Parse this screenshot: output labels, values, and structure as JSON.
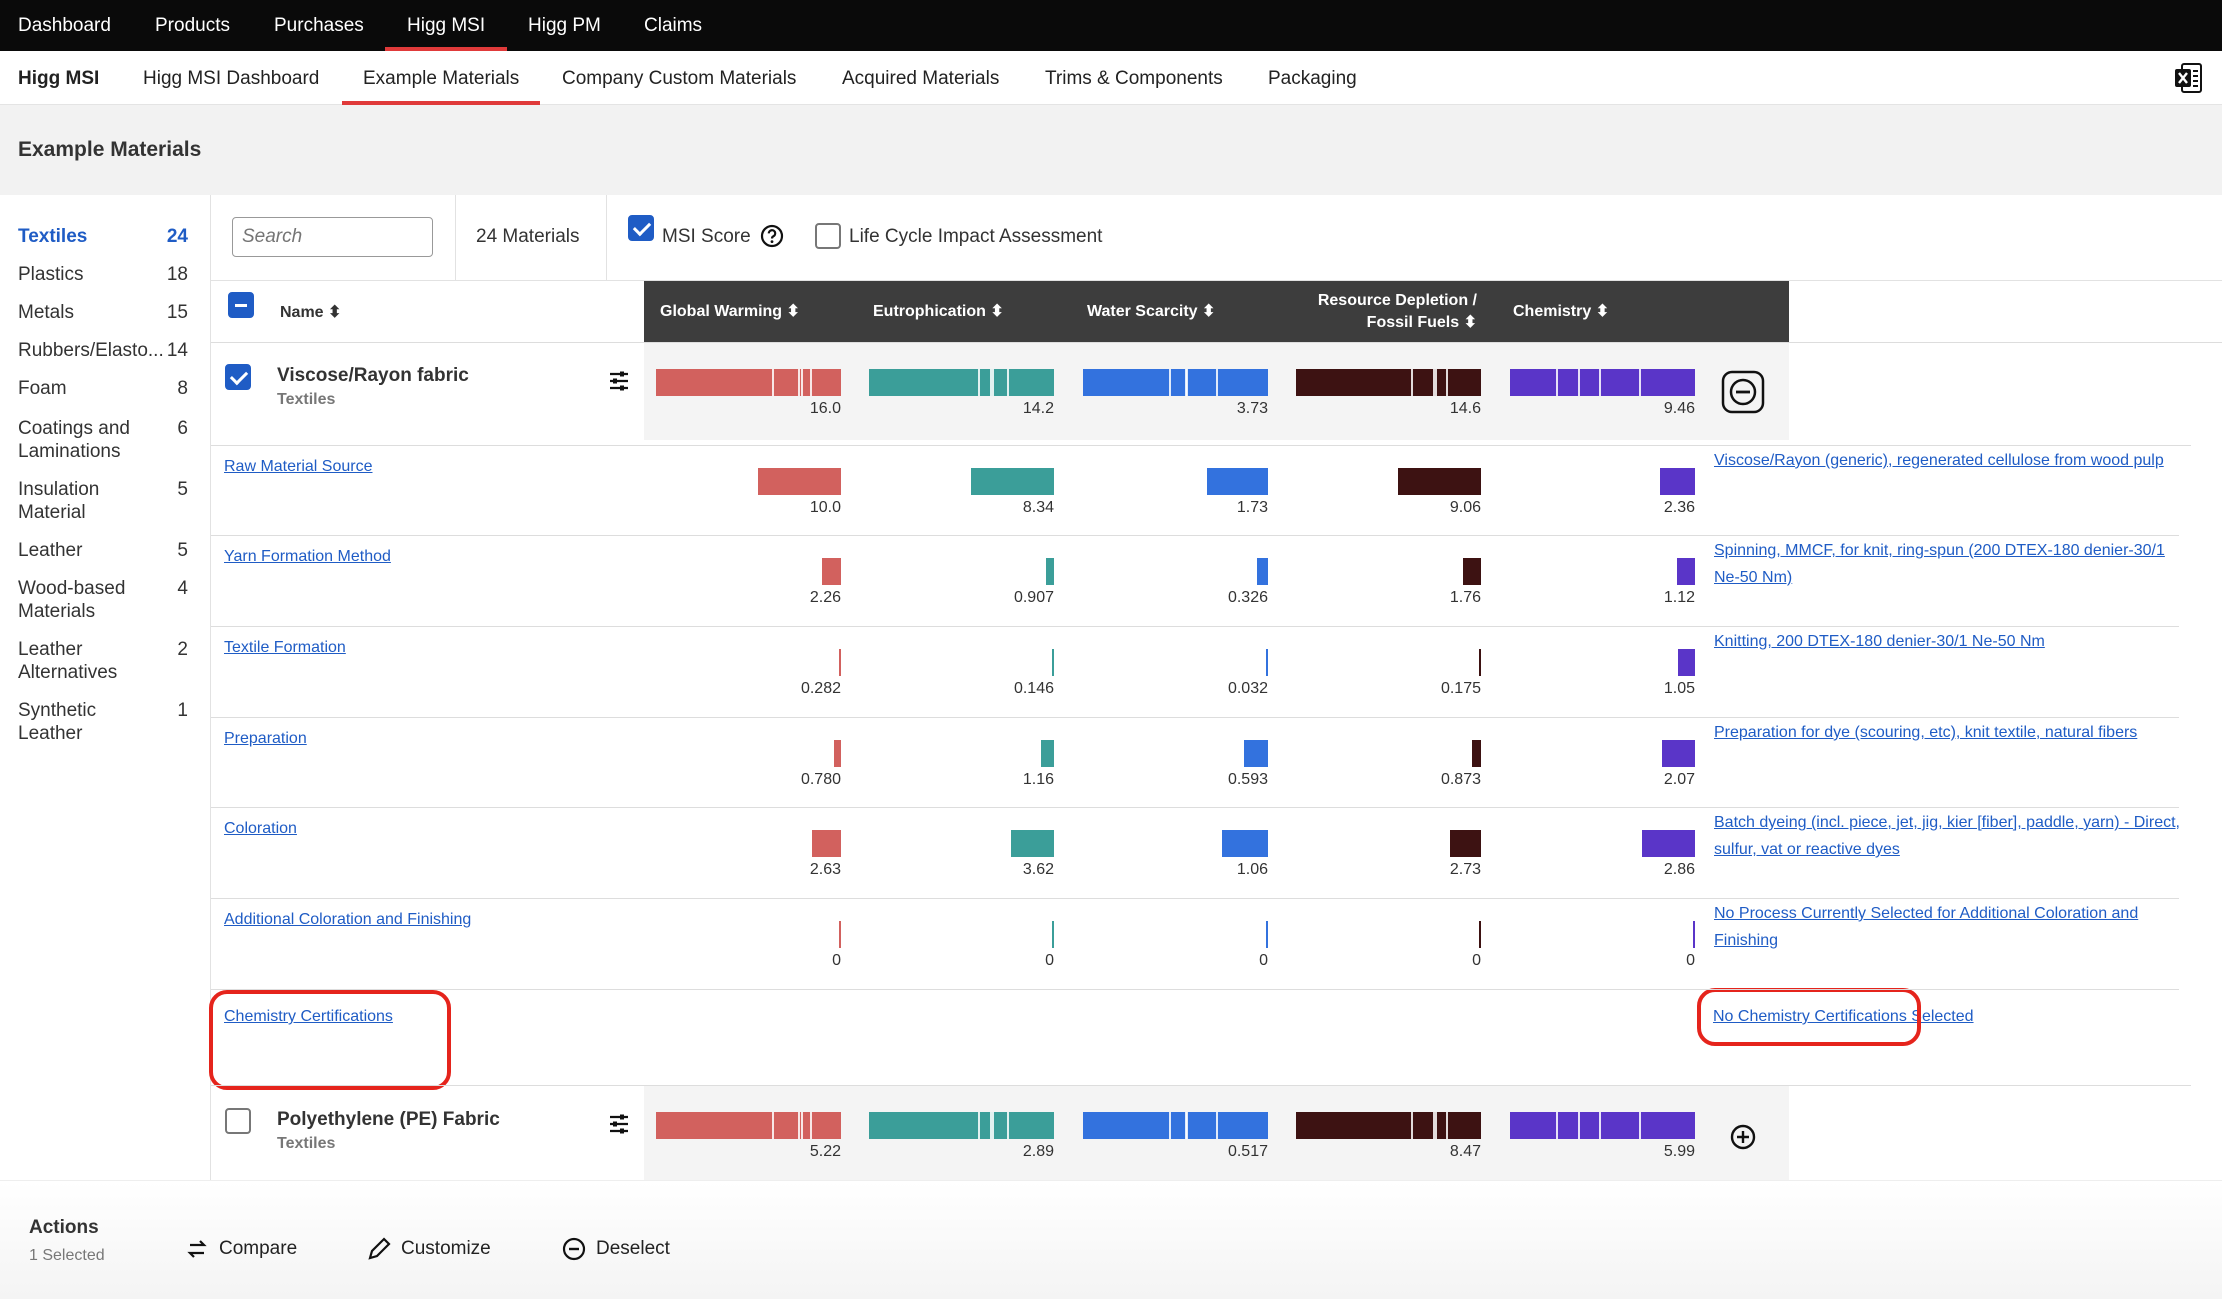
{
  "topnav": {
    "items": [
      "Dashboard",
      "Products",
      "Purchases",
      "Higg MSI",
      "Higg PM",
      "Claims"
    ],
    "active": "Higg MSI"
  },
  "subnav": {
    "brand": "Higg MSI",
    "items": [
      "Higg MSI Dashboard",
      "Example Materials",
      "Company Custom Materials",
      "Acquired Materials",
      "Trims & Components",
      "Packaging"
    ],
    "active": "Example Materials",
    "export_icon": "excel-icon"
  },
  "page": {
    "title": "Example Materials"
  },
  "sidebar": {
    "categories": [
      {
        "label": "Textiles",
        "count": "24",
        "active": true
      },
      {
        "label": "Plastics",
        "count": "18"
      },
      {
        "label": "Metals",
        "count": "15"
      },
      {
        "label": "Rubbers/Elasto...",
        "count": "14"
      },
      {
        "label": "Foam",
        "count": "8"
      },
      {
        "label": "Coatings and Laminations",
        "count": "6"
      },
      {
        "label": "Insulation Material",
        "count": "5"
      },
      {
        "label": "Leather",
        "count": "5"
      },
      {
        "label": "Wood-based Materials",
        "count": "4"
      },
      {
        "label": "Leather Alternatives",
        "count": "2"
      },
      {
        "label": "Synthetic Leather",
        "count": "1"
      }
    ]
  },
  "toolbar": {
    "search_placeholder": "Search",
    "materials_count": "24 Materials",
    "msi_score_label": "MSI Score",
    "msi_score_checked": true,
    "lca_label": "Life Cycle Impact Assessment",
    "lca_checked": false
  },
  "table": {
    "name_header": "Name",
    "columns": [
      "Global Warming",
      "Eutrophication",
      "Water Scarcity",
      "Resource Depletion / Fossil Fuels",
      "Chemistry"
    ],
    "column_colors": [
      "#d2615e",
      "#3b9e99",
      "#3372de",
      "#3d1212",
      "#5a35c8"
    ],
    "materials": [
      {
        "name": "Viscose/Rayon fabric",
        "category": "Textiles",
        "checked": true,
        "scores": [
          "16.0",
          "14.2",
          "3.73",
          "14.6",
          "9.46"
        ],
        "action_icon": "minus-circle-icon"
      },
      {
        "name": "Polyethylene (PE) Fabric",
        "category": "Textiles",
        "checked": false,
        "scores": [
          "5.22",
          "2.89",
          "0.517",
          "8.47",
          "5.99"
        ],
        "action_icon": "plus-circle-icon"
      }
    ],
    "stages": [
      {
        "label": "Raw Material Source",
        "values": [
          "10.0",
          "8.34",
          "1.73",
          "9.06",
          "2.36"
        ],
        "fractions": [
          0.45,
          0.45,
          0.33,
          0.45,
          0.19
        ],
        "description": "Viscose/Rayon (generic), regenerated cellulose from wood pulp"
      },
      {
        "label": "Yarn Formation Method",
        "values": [
          "2.26",
          "0.907",
          "0.326",
          "1.76",
          "1.12"
        ],
        "fractions": [
          0.105,
          0.045,
          0.06,
          0.095,
          0.095
        ],
        "description": "Spinning, MMCF, for knit, ring-spun (200 DTEX-180 denier-30/1 Ne-50 Nm)"
      },
      {
        "label": "Textile Formation",
        "values": [
          "0.282",
          "0.146",
          "0.032",
          "0.175",
          "1.05"
        ],
        "fractions": [
          0.013,
          0.008,
          0.006,
          0.01,
          0.09
        ],
        "description": "Knitting, 200 DTEX-180 denier-30/1 Ne-50 Nm"
      },
      {
        "label": "Preparation",
        "values": [
          "0.780",
          "1.16",
          "0.593",
          "0.873",
          "2.07"
        ],
        "fractions": [
          0.04,
          0.07,
          0.13,
          0.05,
          0.18
        ],
        "description": "Preparation for dye (scouring, etc), knit textile, natural fibers"
      },
      {
        "label": "Coloration",
        "values": [
          "2.63",
          "3.62",
          "1.06",
          "2.73",
          "2.86"
        ],
        "fractions": [
          0.155,
          0.23,
          0.25,
          0.17,
          0.285
        ],
        "description": "Batch dyeing (incl. piece, jet, jig, kier [fiber], paddle, yarn) - Direct, sulfur, vat or reactive dyes"
      },
      {
        "label": "Additional Coloration and Finishing",
        "values": [
          "0",
          "0",
          "0",
          "0",
          "0"
        ],
        "fractions": [
          0,
          0,
          0,
          0,
          0
        ],
        "description": "No Process Currently Selected for Additional Coloration and Finishing"
      }
    ],
    "certification": {
      "label": "Chemistry Certifications",
      "description": "No Chemistry Certifications Selected"
    }
  },
  "actions": {
    "title": "Actions",
    "selected": "1 Selected",
    "compare": "Compare",
    "customize": "Customize",
    "deselect": "Deselect"
  }
}
